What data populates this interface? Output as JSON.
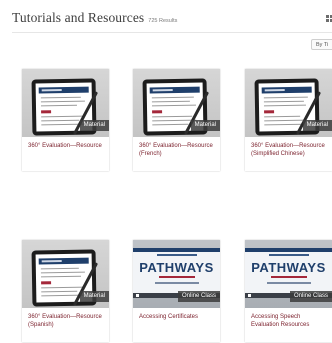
{
  "header": {
    "title": "Tutorials and Resources",
    "count": "725 Results",
    "view_icon": "grid-view-icon"
  },
  "sort": {
    "label": "By Ti"
  },
  "cards": [
    {
      "title": "360° Evaluation—Resource",
      "type": "Material"
    },
    {
      "title": "360° Evaluation—Resource (French)",
      "type": "Material"
    },
    {
      "title": "360° Evaluation—Resource (Simplified Chinese)",
      "type": "Material"
    },
    {
      "title": "360° Evaluation—Resource (Spanish)",
      "type": "Material"
    },
    {
      "title": "Accessing Certificates",
      "type": "Online Class",
      "brand": "PATHWAYS"
    },
    {
      "title": "Accessing Speech Evaluation Resources",
      "type": "Online Class",
      "brand": "PATHWAYS"
    }
  ],
  "colors": {
    "accent": "#7a1f2b",
    "navy": "#1f3f6b"
  }
}
